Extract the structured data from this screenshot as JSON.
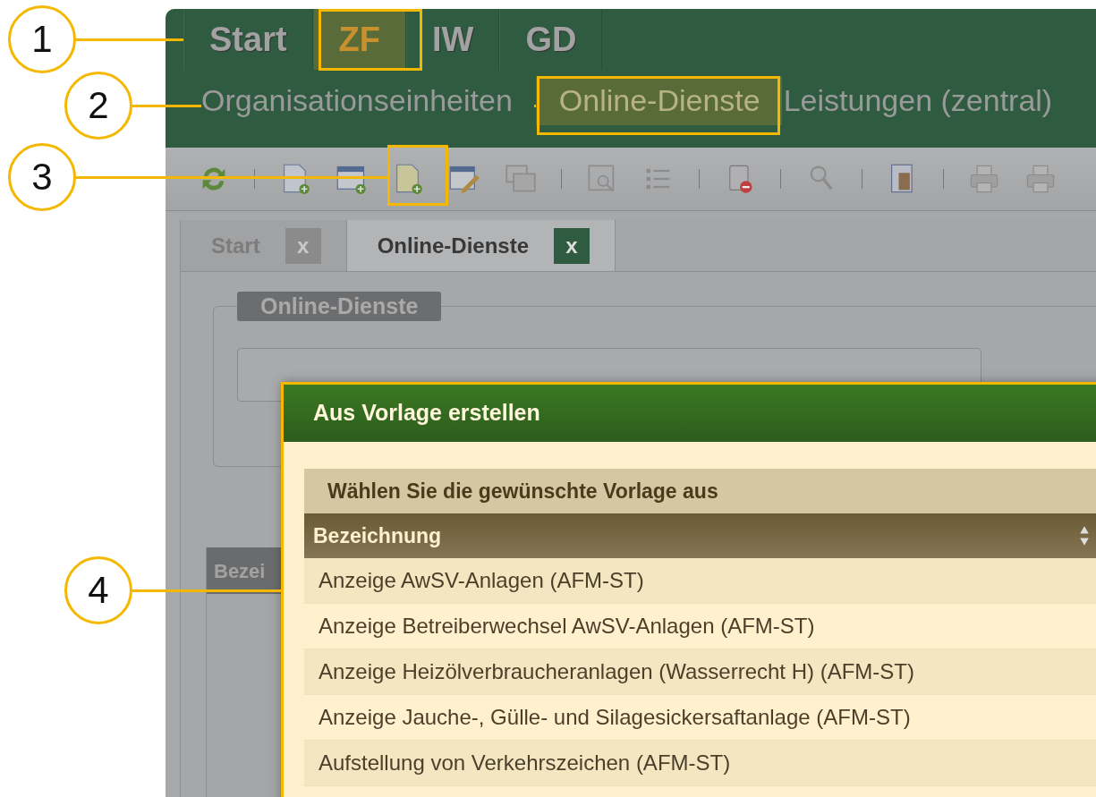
{
  "main_menu": [
    {
      "label": "Start",
      "selected": false
    },
    {
      "label": "ZF",
      "selected": true
    },
    {
      "label": "IW",
      "selected": false
    },
    {
      "label": "GD",
      "selected": false
    }
  ],
  "sub_menu": [
    {
      "label": "Organisationseinheiten",
      "selected": false
    },
    {
      "label": "Online-Dienste",
      "selected": true
    },
    {
      "label": "Leistungen (zentral)",
      "selected": false
    }
  ],
  "tabs": [
    {
      "label": "Start",
      "close": "x",
      "selected": false
    },
    {
      "label": "Online-Dienste",
      "close": "x",
      "selected": true
    }
  ],
  "panel": {
    "legend": "Online-Dienste",
    "column_1": "Bezei"
  },
  "dialog": {
    "title": "Aus Vorlage erstellen",
    "subtitle": "Wählen Sie die gewünschte Vorlage aus",
    "column": "Bezeichnung",
    "rows": [
      "Anzeige AwSV-Anlagen (AFM-ST)",
      "Anzeige Betreiberwechsel AwSV-Anlagen (AFM-ST)",
      "Anzeige Heizölverbraucheranlagen (Wasserrecht H) (AFM-ST)",
      "Anzeige Jauche-, Gülle- und Silagesickersaftanlage (AFM-ST)",
      "Aufstellung von Verkehrszeichen (AFM-ST)"
    ]
  },
  "callouts": [
    "1",
    "2",
    "3",
    "4"
  ]
}
